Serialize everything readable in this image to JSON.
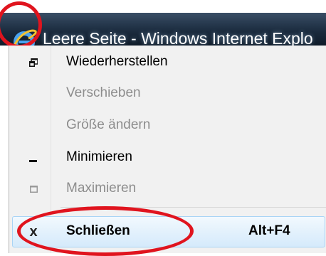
{
  "window": {
    "title": "Leere Seite - Windows Internet Explo",
    "icon": "internet-explorer-icon"
  },
  "system_menu": {
    "items": [
      {
        "label": "Wiederherstellen",
        "icon": "restore-icon",
        "enabled": true
      },
      {
        "label": "Verschieben",
        "icon": "",
        "enabled": false
      },
      {
        "label": "Größe ändern",
        "icon": "",
        "enabled": false
      },
      {
        "label": "Minimieren",
        "icon": "minimize-icon",
        "enabled": true
      },
      {
        "label": "Maximieren",
        "icon": "maximize-icon",
        "enabled": false
      },
      {
        "label": "Schließen",
        "icon": "close-icon",
        "shortcut": "Alt+F4",
        "enabled": true,
        "selected": true
      }
    ],
    "close_glyph": "x"
  },
  "colors": {
    "highlight_border": "#a9d4f5",
    "annotation_red": "#e0141e",
    "disabled_text": "#8d8d8d"
  }
}
